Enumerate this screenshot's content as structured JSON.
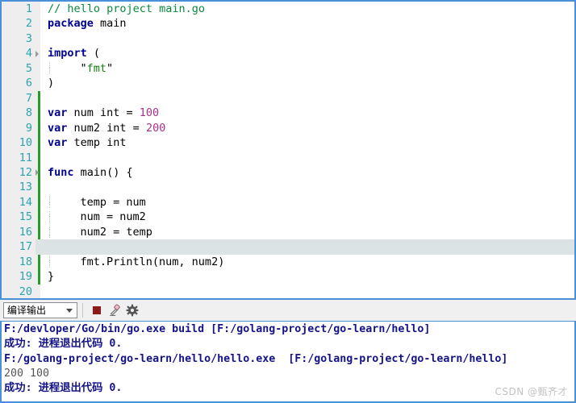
{
  "editor": {
    "gutter_color": "#2ca3ad",
    "change_bar_color": "#2a9b2a",
    "current_line_highlight": "#dce3e5",
    "border_color": "#4a90d9",
    "current_line": 17,
    "lines": [
      {
        "num": "1",
        "fold": false,
        "changed": false,
        "indent": false,
        "tokens": [
          {
            "t": "// hello project main.go",
            "c": "comment"
          }
        ]
      },
      {
        "num": "2",
        "fold": false,
        "changed": false,
        "indent": false,
        "tokens": [
          {
            "t": "package",
            "c": "keyword"
          },
          {
            "t": " main",
            "c": "plain"
          }
        ]
      },
      {
        "num": "3",
        "fold": false,
        "changed": false,
        "indent": false,
        "tokens": [
          {
            "t": "",
            "c": "plain"
          }
        ]
      },
      {
        "num": "4",
        "fold": true,
        "changed": false,
        "indent": false,
        "tokens": [
          {
            "t": "import",
            "c": "keyword"
          },
          {
            "t": " (",
            "c": "punct"
          }
        ]
      },
      {
        "num": "5",
        "fold": false,
        "changed": false,
        "indent": true,
        "tokens": [
          {
            "t": "    \"",
            "c": "punct"
          },
          {
            "t": "fmt",
            "c": "string"
          },
          {
            "t": "\"",
            "c": "punct"
          }
        ]
      },
      {
        "num": "6",
        "fold": false,
        "changed": false,
        "indent": false,
        "tokens": [
          {
            "t": ")",
            "c": "punct"
          }
        ]
      },
      {
        "num": "7",
        "fold": false,
        "changed": true,
        "indent": false,
        "tokens": [
          {
            "t": "",
            "c": "plain"
          }
        ]
      },
      {
        "num": "8",
        "fold": false,
        "changed": true,
        "indent": false,
        "tokens": [
          {
            "t": "var",
            "c": "keyword"
          },
          {
            "t": " num int = ",
            "c": "plain"
          },
          {
            "t": "100",
            "c": "number"
          }
        ]
      },
      {
        "num": "9",
        "fold": false,
        "changed": true,
        "indent": false,
        "tokens": [
          {
            "t": "var",
            "c": "keyword"
          },
          {
            "t": " num2 int = ",
            "c": "plain"
          },
          {
            "t": "200",
            "c": "number"
          }
        ]
      },
      {
        "num": "10",
        "fold": false,
        "changed": true,
        "indent": false,
        "tokens": [
          {
            "t": "var",
            "c": "keyword"
          },
          {
            "t": " temp int",
            "c": "plain"
          }
        ]
      },
      {
        "num": "11",
        "fold": false,
        "changed": true,
        "indent": false,
        "tokens": [
          {
            "t": "",
            "c": "plain"
          }
        ]
      },
      {
        "num": "12",
        "fold": true,
        "changed": true,
        "indent": false,
        "tokens": [
          {
            "t": "func",
            "c": "keyword"
          },
          {
            "t": " main() {",
            "c": "plain"
          }
        ]
      },
      {
        "num": "13",
        "fold": false,
        "changed": true,
        "indent": false,
        "tokens": [
          {
            "t": "",
            "c": "plain"
          }
        ]
      },
      {
        "num": "14",
        "fold": false,
        "changed": true,
        "indent": true,
        "tokens": [
          {
            "t": "    temp = num",
            "c": "plain"
          }
        ]
      },
      {
        "num": "15",
        "fold": false,
        "changed": true,
        "indent": true,
        "tokens": [
          {
            "t": "    num = num2",
            "c": "plain"
          }
        ]
      },
      {
        "num": "16",
        "fold": false,
        "changed": true,
        "indent": true,
        "tokens": [
          {
            "t": "    num2 = temp",
            "c": "plain"
          }
        ]
      },
      {
        "num": "17",
        "fold": false,
        "changed": true,
        "indent": false,
        "tokens": [
          {
            "t": "",
            "c": "plain"
          }
        ]
      },
      {
        "num": "18",
        "fold": false,
        "changed": true,
        "indent": true,
        "tokens": [
          {
            "t": "    fmt.Println(num, num2)",
            "c": "plain"
          }
        ]
      },
      {
        "num": "19",
        "fold": false,
        "changed": true,
        "indent": false,
        "tokens": [
          {
            "t": "}",
            "c": "plain"
          }
        ]
      },
      {
        "num": "20",
        "fold": false,
        "changed": false,
        "indent": false,
        "tokens": [
          {
            "t": "",
            "c": "plain"
          }
        ]
      }
    ]
  },
  "toolbar": {
    "combo_value": "编译输出",
    "stop_icon": "stop-square-icon",
    "clear_icon": "eraser-icon",
    "settings_icon": "gear-icon",
    "stop_color": "#8f1a1a"
  },
  "console": {
    "lines": [
      {
        "text": "F:/devloper/Go/bin/go.exe build [F:/golang-project/go-learn/hello]",
        "style": "info"
      },
      {
        "text": "成功: 进程退出代码 0.",
        "style": "info"
      },
      {
        "text": "F:/golang-project/go-learn/hello/hello.exe  [F:/golang-project/go-learn/hello]",
        "style": "info"
      },
      {
        "text": "200 100",
        "style": "plain"
      },
      {
        "text": "成功: 进程退出代码 0.",
        "style": "info"
      }
    ]
  },
  "watermark": {
    "text": "CSDN @甄齐才"
  }
}
